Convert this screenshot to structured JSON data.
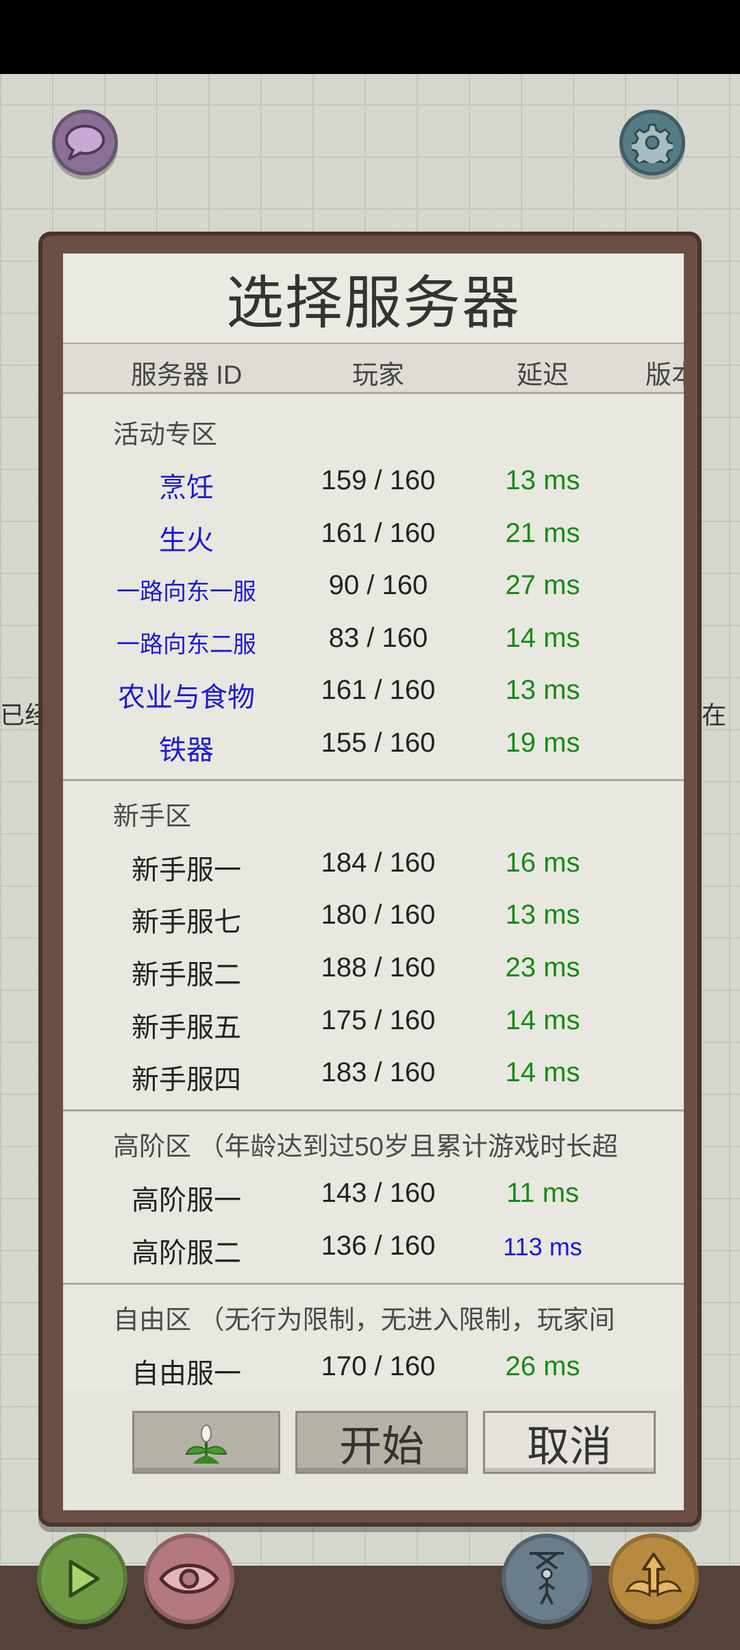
{
  "dialog": {
    "title": "选择服务器",
    "columns": [
      "服务器 ID",
      "玩家",
      "延迟",
      "版本"
    ]
  },
  "side_text": {
    "left": "已经",
    "right": "在"
  },
  "sections": [
    {
      "title": "活动专区",
      "rows": [
        {
          "name": "烹饪",
          "players": "159 / 160",
          "ping": "13 ms"
        },
        {
          "name": "生火",
          "players": "161 / 160",
          "ping": "21 ms"
        },
        {
          "name": "一路向东一服",
          "players": "90 / 160",
          "ping": "27 ms"
        },
        {
          "name": "一路向东二服",
          "players": "83 / 160",
          "ping": "14 ms"
        },
        {
          "name": "农业与食物",
          "players": "161 / 160",
          "ping": "13 ms"
        },
        {
          "name": "铁器",
          "players": "155 / 160",
          "ping": "19 ms"
        }
      ]
    },
    {
      "title": "新手区",
      "rows": [
        {
          "name": "新手服一",
          "players": "184 / 160",
          "ping": "16 ms"
        },
        {
          "name": "新手服七",
          "players": "180 / 160",
          "ping": "13 ms"
        },
        {
          "name": "新手服二",
          "players": "188 / 160",
          "ping": "23 ms"
        },
        {
          "name": "新手服五",
          "players": "175 / 160",
          "ping": "14 ms"
        },
        {
          "name": "新手服四",
          "players": "183 / 160",
          "ping": "14 ms"
        }
      ]
    },
    {
      "title": "高阶区 （年龄达到过50岁且累计游戏时长超",
      "rows": [
        {
          "name": "高阶服一",
          "players": "143 / 160",
          "ping": "11 ms"
        },
        {
          "name": "高阶服二",
          "players": "136 / 160",
          "ping": "113 ms"
        }
      ]
    },
    {
      "title": "自由区 （无行为限制，无进入限制，玩家间",
      "rows": [
        {
          "name": "自由服一",
          "players": "170 / 160",
          "ping": "26 ms"
        }
      ]
    }
  ],
  "buttons": {
    "start": "开始",
    "cancel": "取消"
  },
  "colors": {
    "link": "#1a1ad6",
    "ping_good": "#168a16",
    "ping_mid": "#1a1ad6",
    "frame": "#6b4f45"
  }
}
